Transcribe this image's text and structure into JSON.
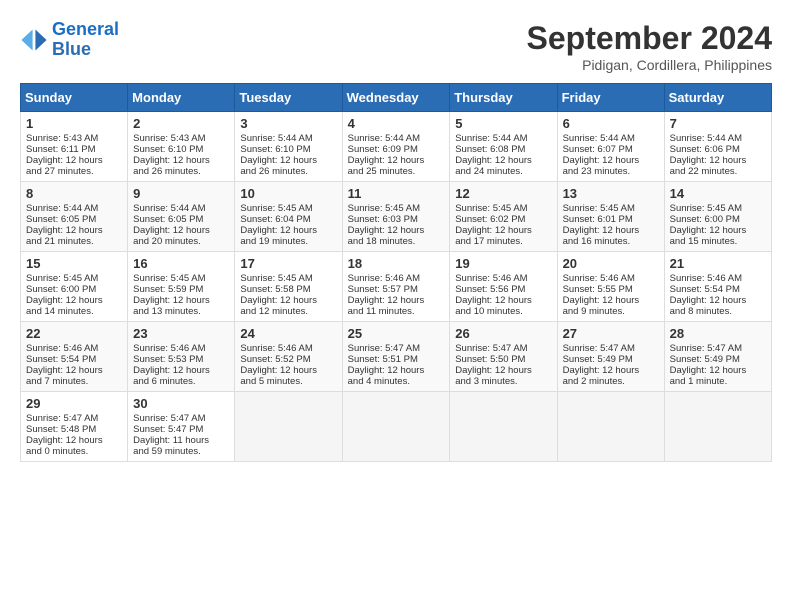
{
  "header": {
    "logo_line1": "General",
    "logo_line2": "Blue",
    "month": "September 2024",
    "location": "Pidigan, Cordillera, Philippines"
  },
  "weekdays": [
    "Sunday",
    "Monday",
    "Tuesday",
    "Wednesday",
    "Thursday",
    "Friday",
    "Saturday"
  ],
  "weeks": [
    [
      {
        "day": "1",
        "lines": [
          "Sunrise: 5:43 AM",
          "Sunset: 6:11 PM",
          "Daylight: 12 hours",
          "and 27 minutes."
        ]
      },
      {
        "day": "2",
        "lines": [
          "Sunrise: 5:43 AM",
          "Sunset: 6:10 PM",
          "Daylight: 12 hours",
          "and 26 minutes."
        ]
      },
      {
        "day": "3",
        "lines": [
          "Sunrise: 5:44 AM",
          "Sunset: 6:10 PM",
          "Daylight: 12 hours",
          "and 26 minutes."
        ]
      },
      {
        "day": "4",
        "lines": [
          "Sunrise: 5:44 AM",
          "Sunset: 6:09 PM",
          "Daylight: 12 hours",
          "and 25 minutes."
        ]
      },
      {
        "day": "5",
        "lines": [
          "Sunrise: 5:44 AM",
          "Sunset: 6:08 PM",
          "Daylight: 12 hours",
          "and 24 minutes."
        ]
      },
      {
        "day": "6",
        "lines": [
          "Sunrise: 5:44 AM",
          "Sunset: 6:07 PM",
          "Daylight: 12 hours",
          "and 23 minutes."
        ]
      },
      {
        "day": "7",
        "lines": [
          "Sunrise: 5:44 AM",
          "Sunset: 6:06 PM",
          "Daylight: 12 hours",
          "and 22 minutes."
        ]
      }
    ],
    [
      {
        "day": "8",
        "lines": [
          "Sunrise: 5:44 AM",
          "Sunset: 6:05 PM",
          "Daylight: 12 hours",
          "and 21 minutes."
        ]
      },
      {
        "day": "9",
        "lines": [
          "Sunrise: 5:44 AM",
          "Sunset: 6:05 PM",
          "Daylight: 12 hours",
          "and 20 minutes."
        ]
      },
      {
        "day": "10",
        "lines": [
          "Sunrise: 5:45 AM",
          "Sunset: 6:04 PM",
          "Daylight: 12 hours",
          "and 19 minutes."
        ]
      },
      {
        "day": "11",
        "lines": [
          "Sunrise: 5:45 AM",
          "Sunset: 6:03 PM",
          "Daylight: 12 hours",
          "and 18 minutes."
        ]
      },
      {
        "day": "12",
        "lines": [
          "Sunrise: 5:45 AM",
          "Sunset: 6:02 PM",
          "Daylight: 12 hours",
          "and 17 minutes."
        ]
      },
      {
        "day": "13",
        "lines": [
          "Sunrise: 5:45 AM",
          "Sunset: 6:01 PM",
          "Daylight: 12 hours",
          "and 16 minutes."
        ]
      },
      {
        "day": "14",
        "lines": [
          "Sunrise: 5:45 AM",
          "Sunset: 6:00 PM",
          "Daylight: 12 hours",
          "and 15 minutes."
        ]
      }
    ],
    [
      {
        "day": "15",
        "lines": [
          "Sunrise: 5:45 AM",
          "Sunset: 6:00 PM",
          "Daylight: 12 hours",
          "and 14 minutes."
        ]
      },
      {
        "day": "16",
        "lines": [
          "Sunrise: 5:45 AM",
          "Sunset: 5:59 PM",
          "Daylight: 12 hours",
          "and 13 minutes."
        ]
      },
      {
        "day": "17",
        "lines": [
          "Sunrise: 5:45 AM",
          "Sunset: 5:58 PM",
          "Daylight: 12 hours",
          "and 12 minutes."
        ]
      },
      {
        "day": "18",
        "lines": [
          "Sunrise: 5:46 AM",
          "Sunset: 5:57 PM",
          "Daylight: 12 hours",
          "and 11 minutes."
        ]
      },
      {
        "day": "19",
        "lines": [
          "Sunrise: 5:46 AM",
          "Sunset: 5:56 PM",
          "Daylight: 12 hours",
          "and 10 minutes."
        ]
      },
      {
        "day": "20",
        "lines": [
          "Sunrise: 5:46 AM",
          "Sunset: 5:55 PM",
          "Daylight: 12 hours",
          "and 9 minutes."
        ]
      },
      {
        "day": "21",
        "lines": [
          "Sunrise: 5:46 AM",
          "Sunset: 5:54 PM",
          "Daylight: 12 hours",
          "and 8 minutes."
        ]
      }
    ],
    [
      {
        "day": "22",
        "lines": [
          "Sunrise: 5:46 AM",
          "Sunset: 5:54 PM",
          "Daylight: 12 hours",
          "and 7 minutes."
        ]
      },
      {
        "day": "23",
        "lines": [
          "Sunrise: 5:46 AM",
          "Sunset: 5:53 PM",
          "Daylight: 12 hours",
          "and 6 minutes."
        ]
      },
      {
        "day": "24",
        "lines": [
          "Sunrise: 5:46 AM",
          "Sunset: 5:52 PM",
          "Daylight: 12 hours",
          "and 5 minutes."
        ]
      },
      {
        "day": "25",
        "lines": [
          "Sunrise: 5:47 AM",
          "Sunset: 5:51 PM",
          "Daylight: 12 hours",
          "and 4 minutes."
        ]
      },
      {
        "day": "26",
        "lines": [
          "Sunrise: 5:47 AM",
          "Sunset: 5:50 PM",
          "Daylight: 12 hours",
          "and 3 minutes."
        ]
      },
      {
        "day": "27",
        "lines": [
          "Sunrise: 5:47 AM",
          "Sunset: 5:49 PM",
          "Daylight: 12 hours",
          "and 2 minutes."
        ]
      },
      {
        "day": "28",
        "lines": [
          "Sunrise: 5:47 AM",
          "Sunset: 5:49 PM",
          "Daylight: 12 hours",
          "and 1 minute."
        ]
      }
    ],
    [
      {
        "day": "29",
        "lines": [
          "Sunrise: 5:47 AM",
          "Sunset: 5:48 PM",
          "Daylight: 12 hours",
          "and 0 minutes."
        ]
      },
      {
        "day": "30",
        "lines": [
          "Sunrise: 5:47 AM",
          "Sunset: 5:47 PM",
          "Daylight: 11 hours",
          "and 59 minutes."
        ]
      },
      null,
      null,
      null,
      null,
      null
    ]
  ]
}
